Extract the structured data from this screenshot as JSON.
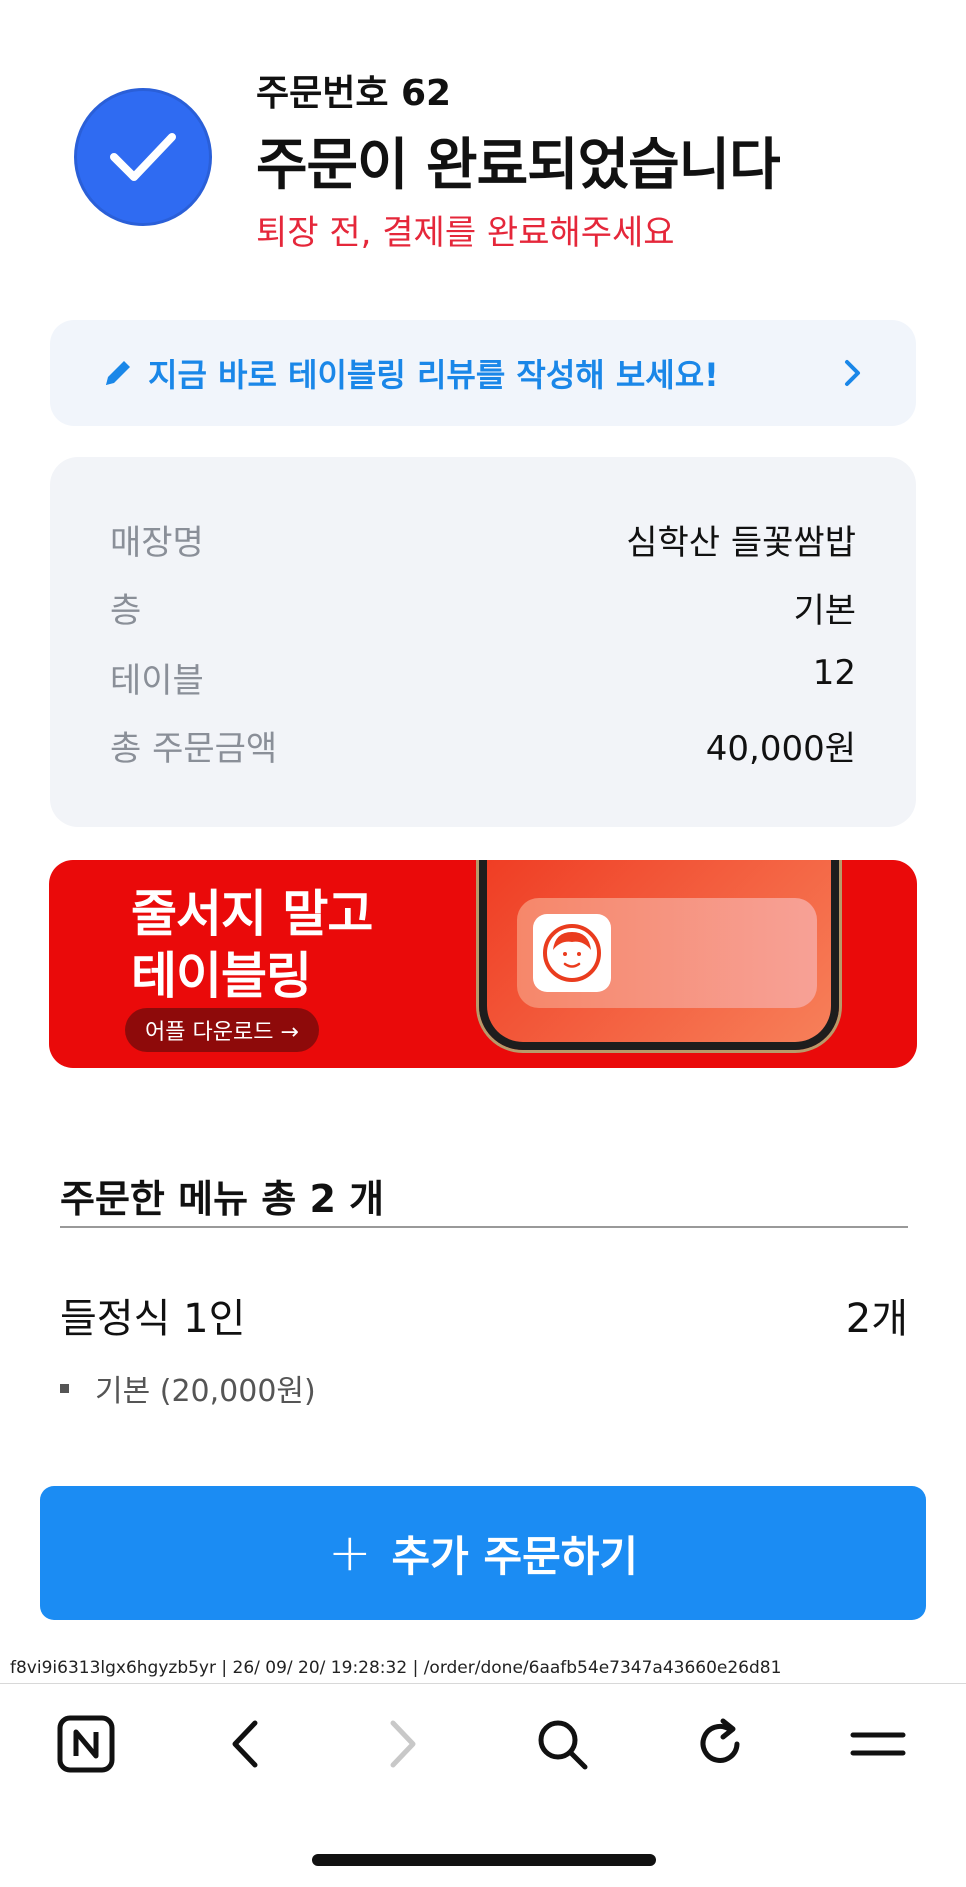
{
  "header": {
    "order_number": "주문번호 62",
    "title": "주문이 완료되었습니다",
    "warning": "퇴장 전, 결제를 완료해주세요",
    "warning_color": "#e5273a"
  },
  "review_banner": {
    "text": "지금 바로 테이블링 리뷰를 작성해 보세요!",
    "icon": "pencil-icon",
    "color": "#1a87e8"
  },
  "info": {
    "rows": [
      {
        "label": "매장명",
        "value": "심학산 들꽃쌈밥"
      },
      {
        "label": "층",
        "value": "기본"
      },
      {
        "label": "테이블",
        "value": "12"
      },
      {
        "label": "총 주문금액",
        "value": "40,000원"
      }
    ]
  },
  "promo": {
    "line1": "줄서지 말고",
    "line2": "테이블링",
    "button": "어플 다운로드 →",
    "bg_color": "#ea0a0a"
  },
  "menu": {
    "header": "주문한 메뉴 총 2 개",
    "items": [
      {
        "name": "들정식 1인",
        "qty": "2개",
        "option": "기본 (20,000원)"
      }
    ]
  },
  "cta": {
    "plus": "+",
    "label": "추가 주문하기",
    "color": "#1b8cf3"
  },
  "status_line": "f8vi9i6313lgx6hgyzb5yr | 26/ 09/ 20/ 19:28:32 | /order/done/6aafb54e7347a43660e26d81",
  "toolbar": {
    "icons": [
      "naver-home-icon",
      "back-icon",
      "forward-icon",
      "search-icon",
      "refresh-icon",
      "menu-icon"
    ]
  }
}
